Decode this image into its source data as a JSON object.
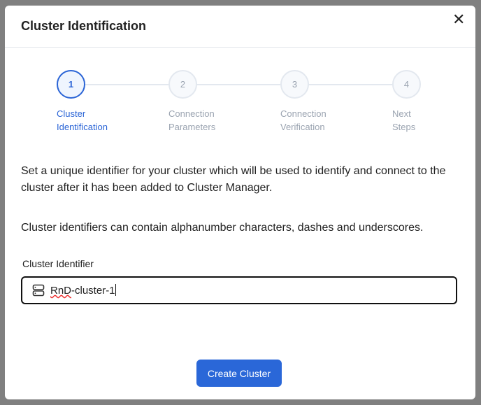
{
  "modal": {
    "title": "Cluster Identification",
    "close_icon": "close-icon",
    "steps": [
      {
        "number": "1",
        "line1": "Cluster",
        "line2": "Identification",
        "active": true
      },
      {
        "number": "2",
        "line1": "Connection",
        "line2": "Parameters",
        "active": false
      },
      {
        "number": "3",
        "line1": "Connection",
        "line2": "Verification",
        "active": false
      },
      {
        "number": "4",
        "line1": "Next",
        "line2": "Steps",
        "active": false
      }
    ],
    "description": "Set a unique identifier for your cluster which will be used to identify and connect to the cluster after it has been added to Cluster Manager.",
    "hint": "Cluster identifiers can contain alphanumber characters, dashes and underscores.",
    "field": {
      "label": "Cluster Identifier",
      "value_misspelled": "RnD",
      "value_rest": "-cluster-1",
      "icon": "server-icon"
    },
    "submit_label": "Create Cluster"
  },
  "colors": {
    "accent": "#2a67d8",
    "overlay": "#808080"
  }
}
